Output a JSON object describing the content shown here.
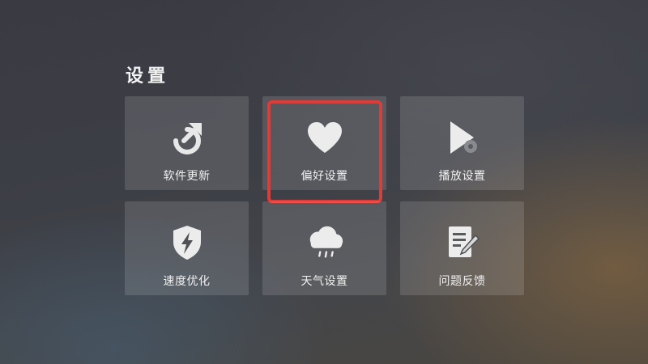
{
  "page": {
    "title": "设置"
  },
  "tiles": [
    {
      "label": "软件更新",
      "icon": "update-arrow-icon"
    },
    {
      "label": "偏好设置",
      "icon": "heart-icon",
      "focused": true
    },
    {
      "label": "播放设置",
      "icon": "play-settings-icon"
    },
    {
      "label": "速度优化",
      "icon": "speed-shield-icon"
    },
    {
      "label": "天气设置",
      "icon": "weather-cloud-icon"
    },
    {
      "label": "问题反馈",
      "icon": "feedback-note-icon"
    }
  ],
  "colors": {
    "focus_outline": "#e53935",
    "tile_bg": "rgba(255,255,255,0.13)",
    "text": "#f0f0f0"
  }
}
